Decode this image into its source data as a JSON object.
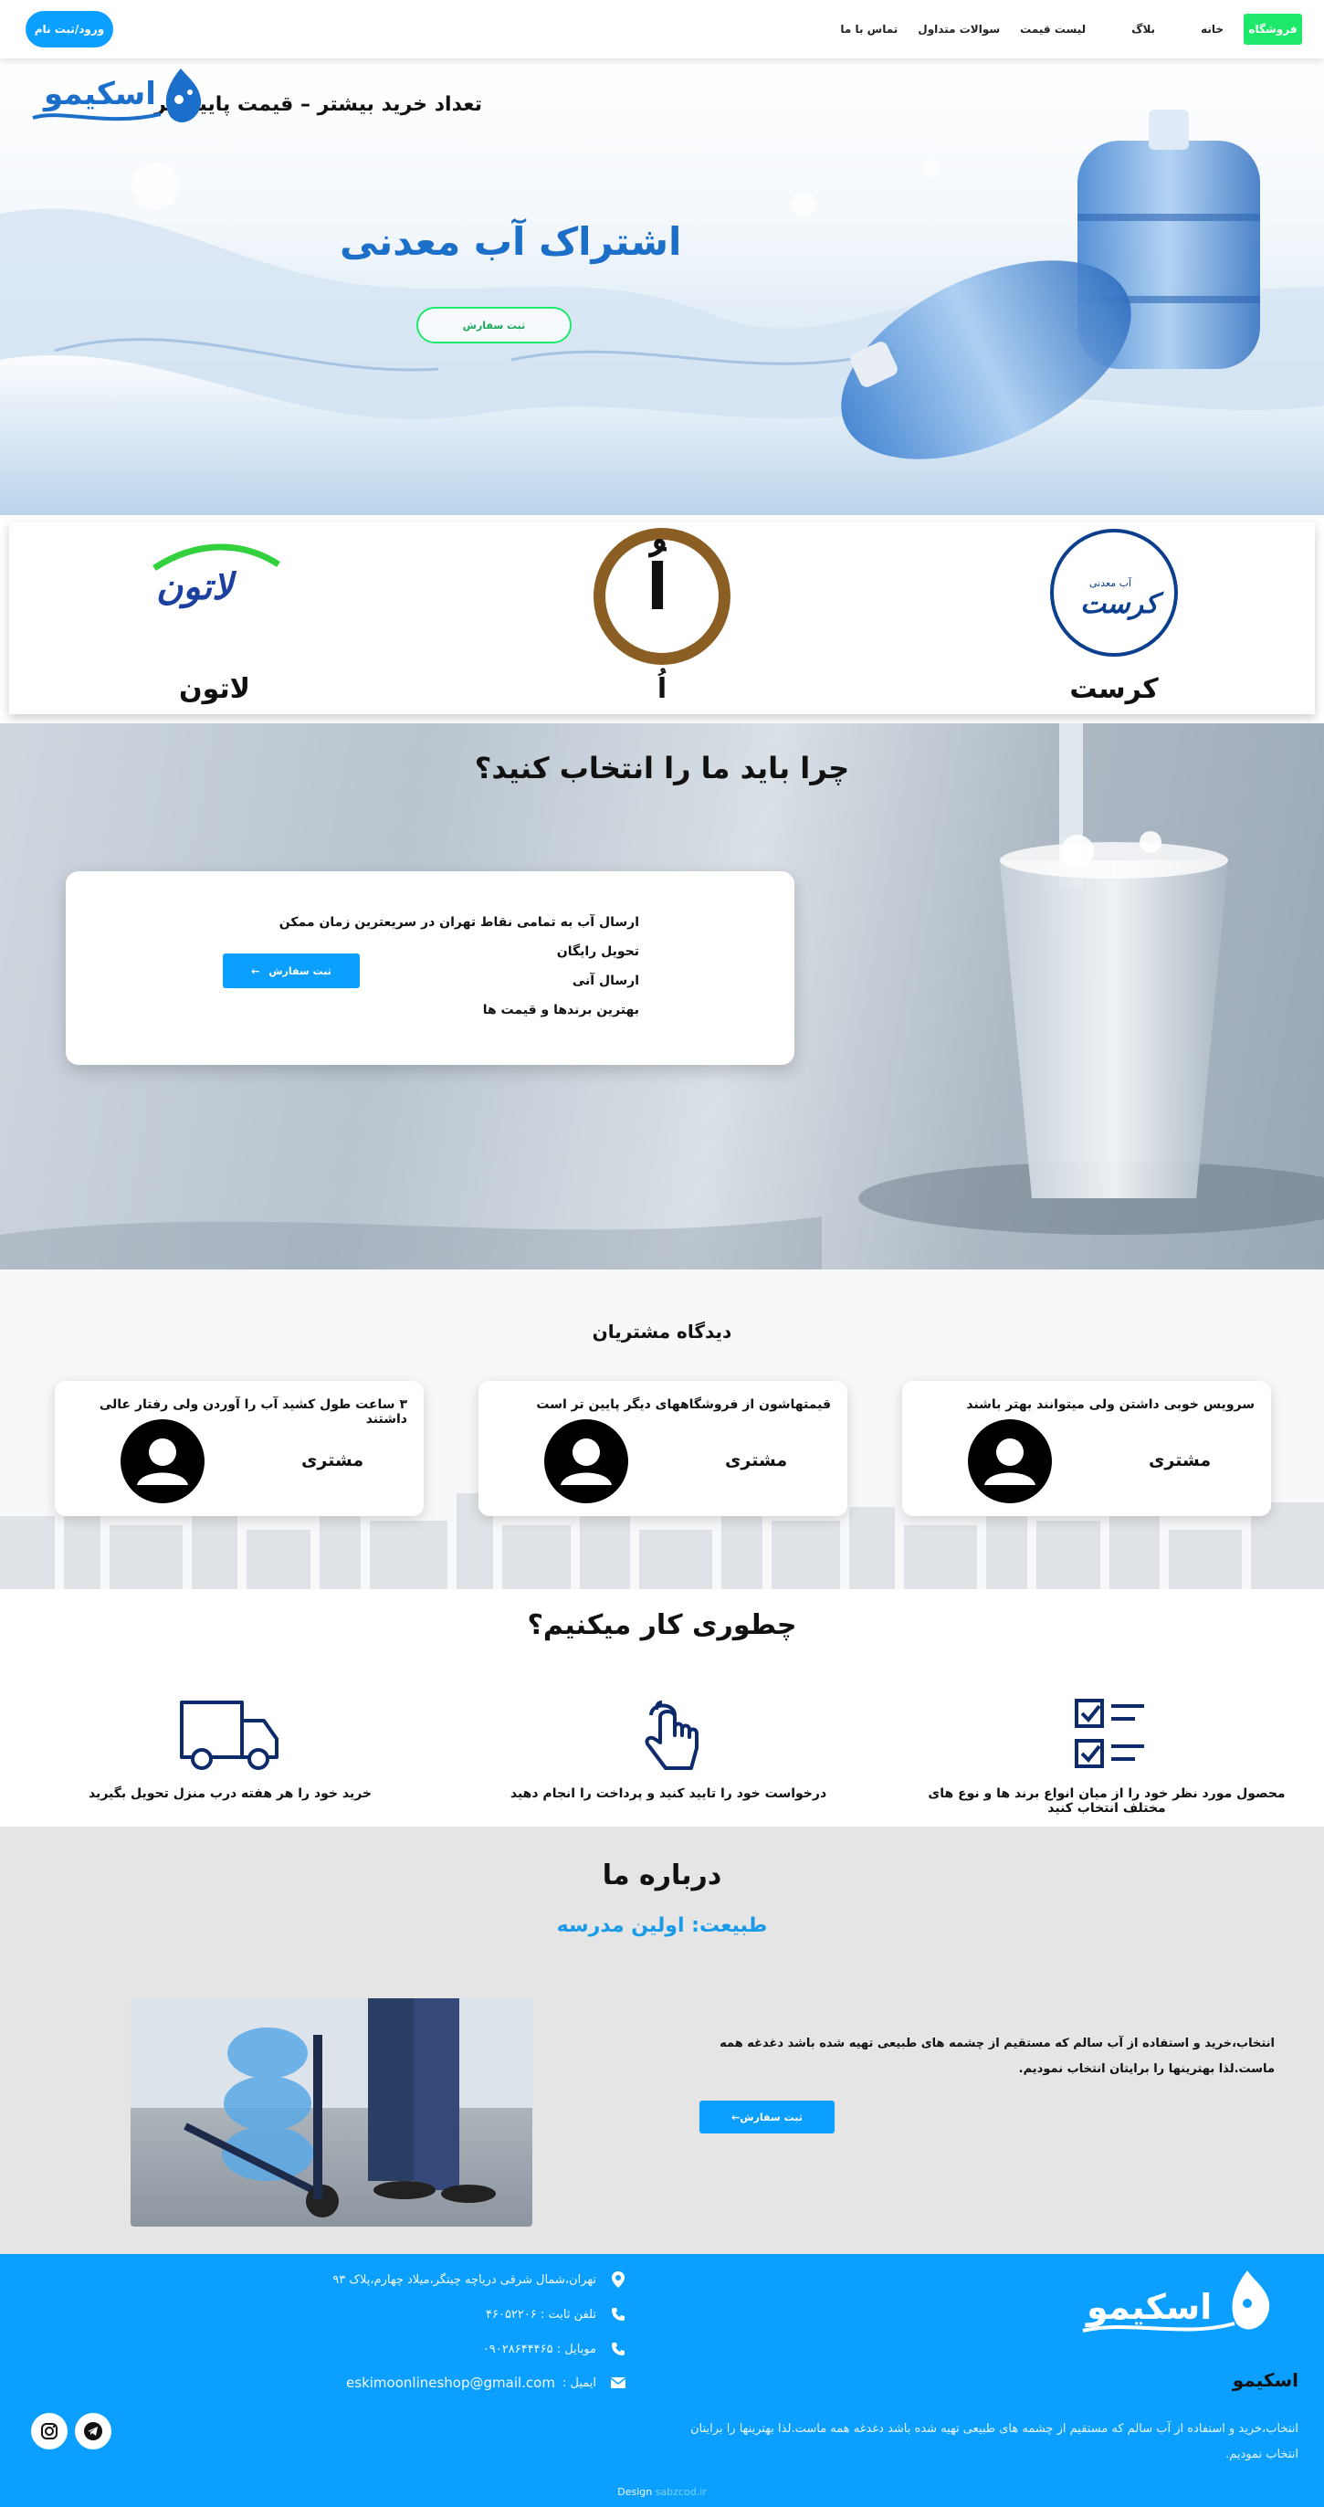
{
  "nav": {
    "shop": "فروشگاه",
    "items": [
      "خانه",
      "بلاگ",
      "لیست قیمت",
      "سوالات متداول",
      "تماس با ما"
    ],
    "login": "ورود/ثبت نام"
  },
  "hero": {
    "tagline": "تعداد خرید بیشتر – قیمت پایین تر",
    "title": "اشتراک آب معدنی",
    "cta": "ثبت سفارش",
    "logo_text": "اسکیمو"
  },
  "brands": [
    {
      "name": "کرست",
      "logo_text": "کرست",
      "logo_sub": "آب معدنی"
    },
    {
      "name": "اُ",
      "logo_text": "اُ"
    },
    {
      "name": "لاتون",
      "logo_text": "لاتون"
    }
  ],
  "why": {
    "title": "چرا باید ما را انتخاب کنید؟",
    "items": [
      "ارسال آب به تمامی نقاط تهران در سریعترین زمان ممکن",
      "تحویل رایگان",
      "ارسال آنی",
      "بهترین برندها و قیمت ها"
    ],
    "order": "ثبت سفارش",
    "order_arrow": "←"
  },
  "testimonials": {
    "title": "دیدگاه مشتریان",
    "items": [
      {
        "quote": "سرویس خوبی داشتن ولی میتوانند بهتر باشند",
        "name": "مشتری"
      },
      {
        "quote": "قیمتهاشون از فروشگاههای دیگر پایین تر است",
        "name": "مشتری"
      },
      {
        "quote": "۳ ساعت طول کشید آب را آوردن ولی رفتار عالی داشتند",
        "name": "مشتری"
      }
    ]
  },
  "how": {
    "title": "چطوری کار میکنیم؟",
    "steps": [
      {
        "text": "محصول مورد نظر خود را از میان انواع برند ها و نوع های مختلف انتخاب کنید",
        "icon": "checklist-icon"
      },
      {
        "text": "درخواست خود را تایید کنید و پرداخت را انجام دهید",
        "icon": "tap-hand-icon"
      },
      {
        "text": "خرید خود را هر هفته درب منزل تحویل بگیرید",
        "icon": "delivery-truck-icon"
      }
    ]
  },
  "about": {
    "title": "درباره ما",
    "subtitle": "طبیعت: اولین مدرسه",
    "text": "انتخاب،خرید و استفاده از آب سالم که مستقیم از چشمه های طبیعی تهیه شده باشد دغدغه همه ماست.لذا بهترینها را برایتان انتخاب نمودیم.",
    "button": "ثبت سفارش←"
  },
  "footer": {
    "logo_text": "اسکیمو",
    "name": "اسکیمو",
    "description": "انتخاب،خرید و استفاده از آب سالم که مستقیم از چشمه های طبیعی تهیه شده باشد دغدغه همه ماست.لذا بهترینها را برایتان انتخاب نمودیم.",
    "address": "تهران،شمال شرقی دریاچه چیتگر،میلاد چهارم،پلاک ۹۳",
    "phone": "تلفن ثابت : ۴۶۰۵۲۲۰۶",
    "mobile": "موبایل : ۰۹۰۲۸۶۴۴۴۶۵",
    "email_label": "ایمیل :",
    "email": "eskimoonlineshop@gmail.com",
    "credit_prefix": "Design",
    "credit_link": "sabzcod.ir"
  },
  "colors": {
    "primary_blue": "#0ba0ff",
    "green": "#1ee86a",
    "hero_title": "#1c6fc8",
    "brand_brown": "#8b5e23",
    "navy": "#0d2a6b"
  }
}
